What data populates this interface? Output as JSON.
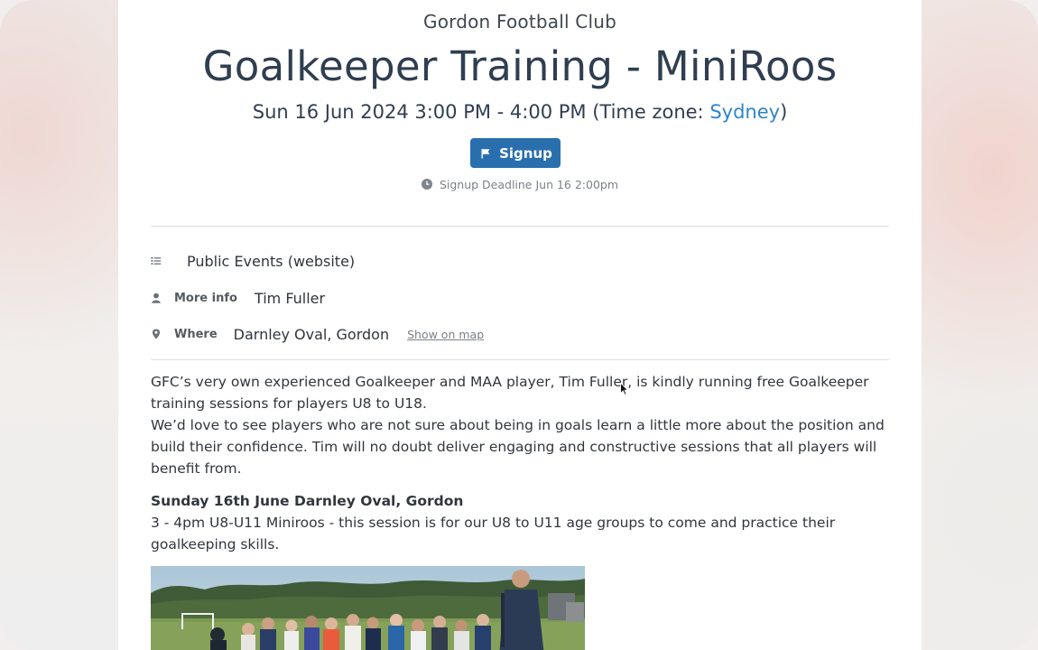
{
  "club_name": "Gordon Football Club",
  "event": {
    "title": "Goalkeeper Training - MiniRoos",
    "datetime": "Sun 16 Jun 2024 3:00 PM - 4:00 PM (Time zone: ",
    "timezone_link": "Sydney",
    "datetime_close": ")"
  },
  "signup": {
    "button_label": "Signup",
    "deadline": "Signup Deadline Jun 16 2:00pm"
  },
  "meta": {
    "category": "Public Events (website)",
    "contact_label": "More info",
    "contact_value": "Tim Fuller",
    "where_label": "Where",
    "where_value": "Darnley Oval, Gordon",
    "map_link": "Show on map"
  },
  "description": {
    "para1": "GFC’s very own experienced Goalkeeper and MAA player, Tim Fuller, is kindly running free Goalkeeper training sessions for players U8 to U18.",
    "para2": "We’d love to see players who are not sure about being in goals learn a little more about the position and build their confidence. Tim will no doubt deliver engaging and constructive sessions that all players will benefit from.",
    "session_heading": "Sunday 16th June Darnley Oval, Gordon",
    "session_detail": "3 - 4pm U8-U11 Miniroos - this session is for our U8 to U11 age groups to come and practice their goalkeeping skills."
  },
  "icons": {
    "signup": "flag-icon",
    "deadline": "clock-icon",
    "category": "list-icon",
    "contact": "person-icon",
    "where": "map-pin-icon"
  },
  "colors": {
    "title_text": "#2f3e50",
    "link": "#2d86c5",
    "button_bg": "#2a6fad"
  }
}
